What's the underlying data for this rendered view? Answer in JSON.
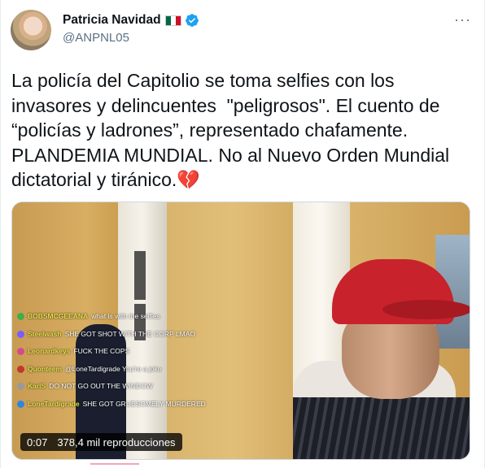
{
  "author": {
    "name": "Patricia Navidad",
    "handle": "@ANPNL05",
    "flag_colors": [
      "#006847",
      "#ffffff",
      "#ce1126"
    ],
    "verified_color": "#1da1f2"
  },
  "more_icon": "···",
  "tweet_text": "La policía del Capitolio se toma selfies con los invasores y delincuentes  \"peligrosos\". El cuento de “policías y ladrones”, representado chafamente. PLANDEMIA MUNDIAL. No al Nuevo Orden Mundial dictatorial y tiránico.",
  "tweet_emoji": "💔",
  "video": {
    "elapsed": "0:07",
    "views": "378,4 mil reproducciones",
    "chat": [
      {
        "user": "BOBSMCGEEANA",
        "msg": "what is with the selfies",
        "color": "#3fae49"
      },
      {
        "user": "Steelwash",
        "msg": "SHE GOT SHOT WITH THE CORP LMAO",
        "color": "#7a5cff"
      },
      {
        "user": "Leonardkeys",
        "msg": "FUCK THE COPS",
        "color": "#d64a8a"
      },
      {
        "user": "Quonteem",
        "msg": "@LoneTardigrade You're a joke",
        "color": "#c0392b"
      },
      {
        "user": "KarlS",
        "msg": "DO NOT GO OUT THE WINDOW",
        "color": "#999999"
      },
      {
        "user": "LoneTardigrade",
        "msg": "SHE GOT GRUESOMELY MURDERED",
        "color": "#2e86de"
      }
    ]
  }
}
